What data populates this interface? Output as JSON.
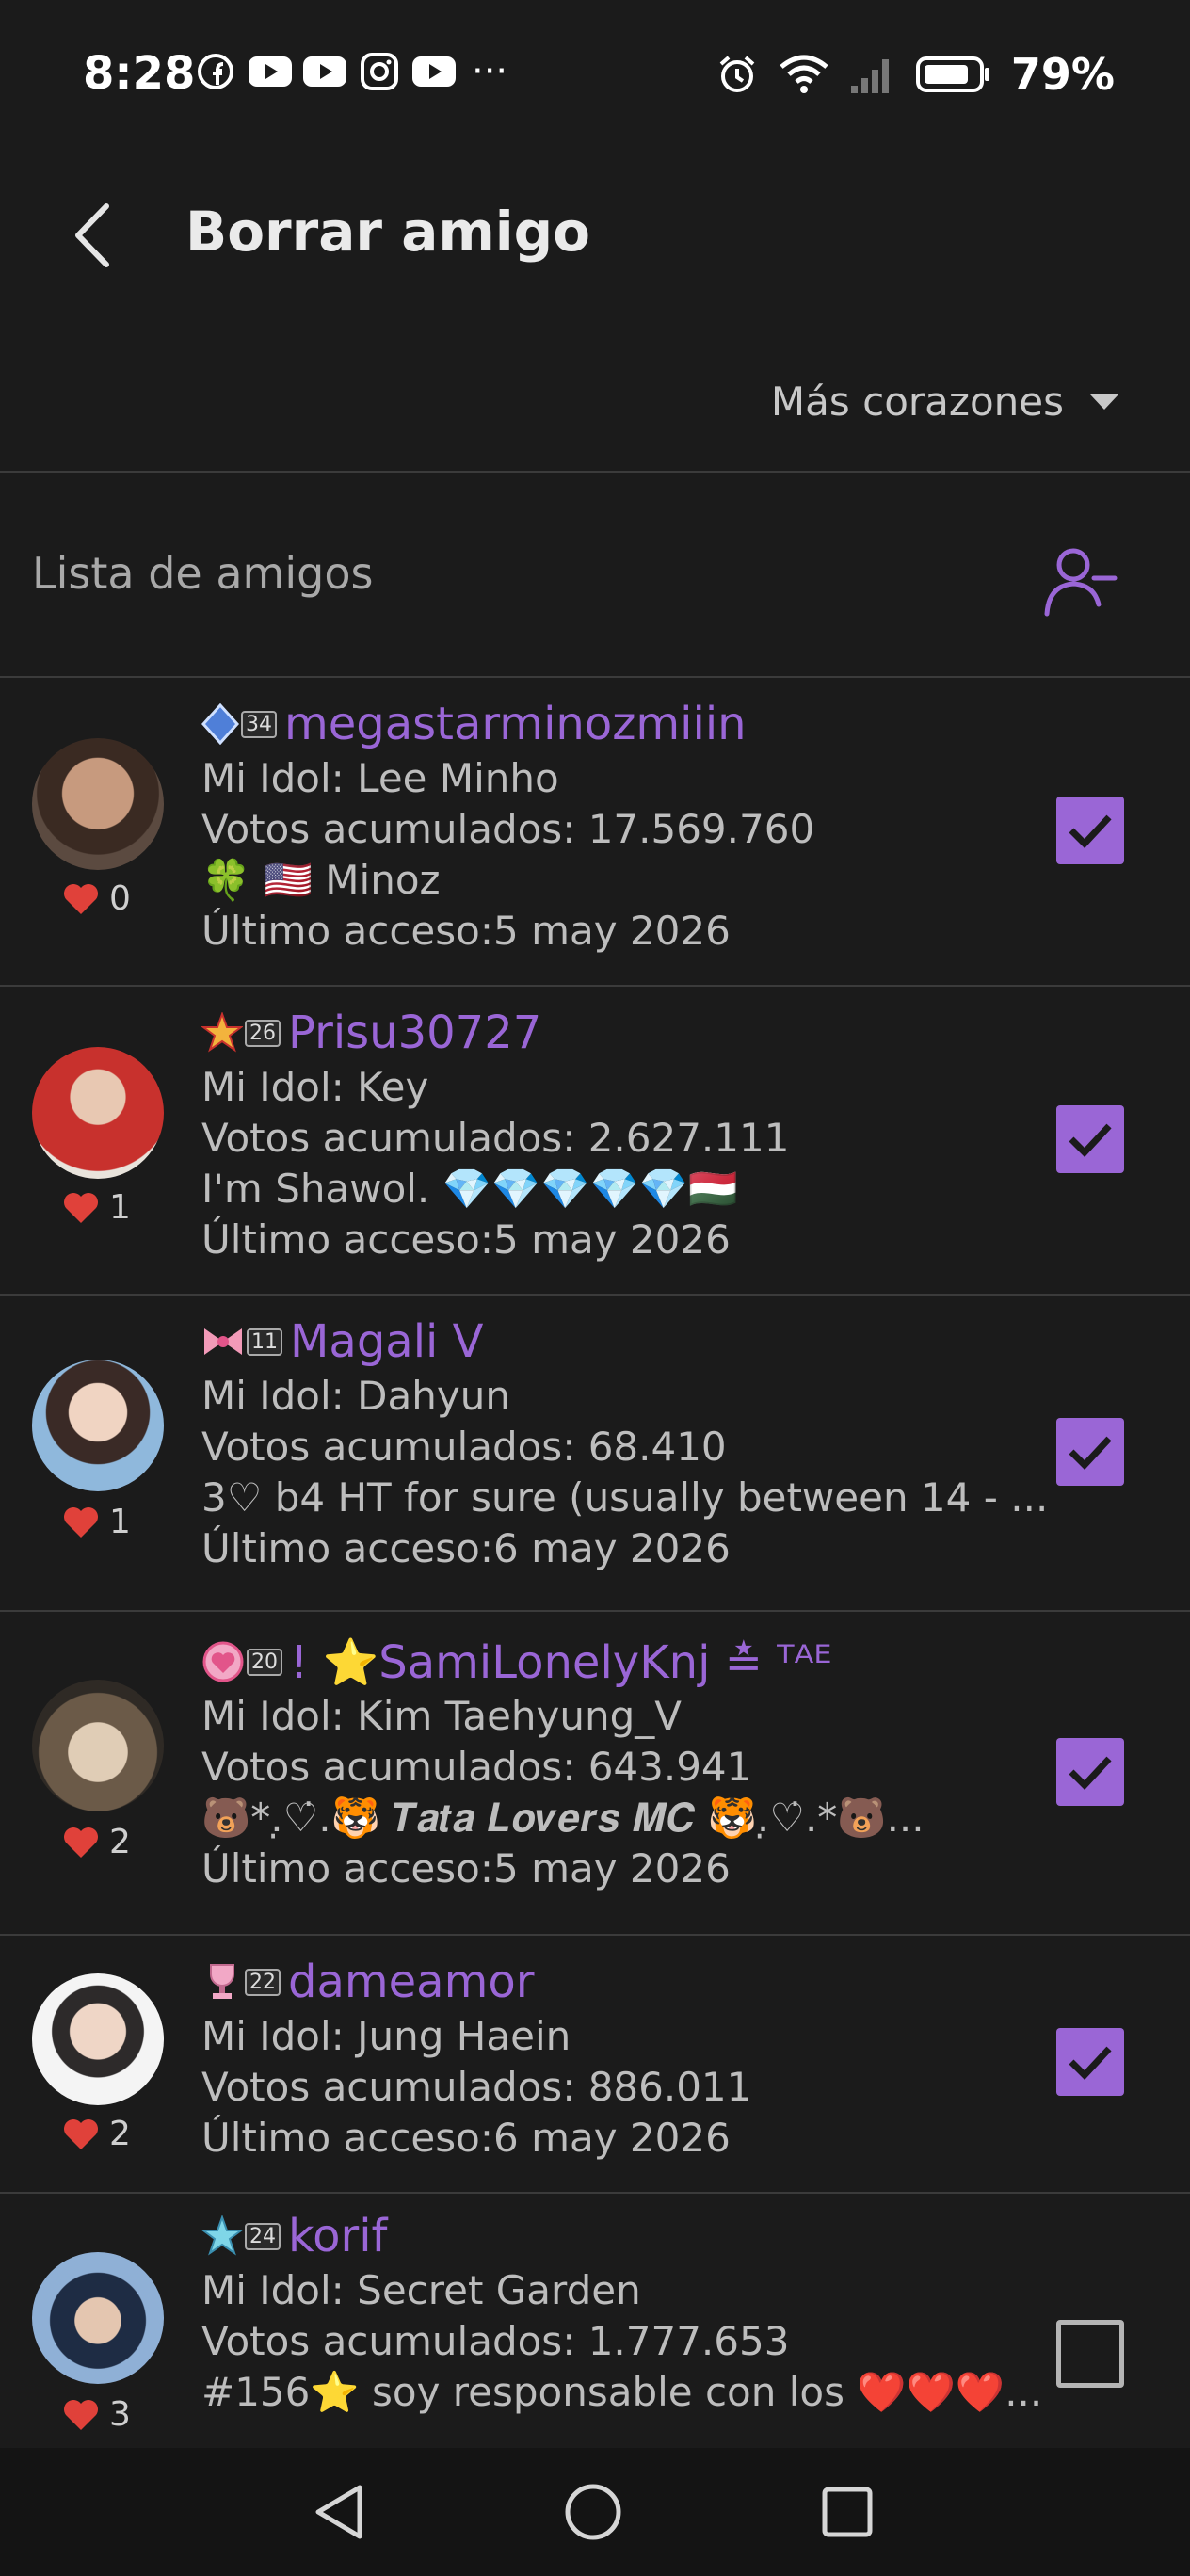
{
  "status_bar": {
    "time": "8:28",
    "battery": "79%"
  },
  "header": {
    "title": "Borrar amigo"
  },
  "sort": {
    "label": "Más corazones"
  },
  "list": {
    "title": "Lista de amigos"
  },
  "friends": [
    {
      "level": "34",
      "name": "megastarminozmiiin",
      "hearts": "0",
      "idol": "Mi Idol: Lee Minho",
      "votes": "Votos acumulados: 17.569.760",
      "status": "🍀 🇺🇸 Minoz",
      "last": "Último acceso:5 may 2026",
      "checked": true
    },
    {
      "level": "26",
      "name": "Prisu30727",
      "hearts": "1",
      "idol": "Mi Idol: Key",
      "votes": "Votos acumulados: 2.627.111",
      "status": "I'm Shawol. 💎💎💎💎💎🇭🇺",
      "last": "Último acceso:5 may 2026",
      "checked": true
    },
    {
      "level": "11",
      "name": "Magali V",
      "hearts": "1",
      "idol": "Mi Idol: Dahyun",
      "votes": "Votos acumulados: 68.410",
      "status": " 3♡ b4 HT for sure (usually between 14 - ...",
      "last": "Último acceso:6 may 2026",
      "checked": true
    },
    {
      "level": "20",
      "name": "! ⭐SamiLonelyKnj ≛ ᵀᴬᴱ",
      "hearts": "2",
      "idol": "Mi Idol: Kim Taehyung_V",
      "votes": "Votos acumulados: 643.941",
      "status": "🐻*.̣♡̇.🐯 𝑻𝒂𝒕𝒂 𝑳𝒐𝒗𝒆𝒓𝒔 𝑴𝑪 🐯.̣♡̇.*🐻...",
      "last": "Último acceso:5 may 2026",
      "checked": true
    },
    {
      "level": "22",
      "name": "dameamor",
      "hearts": "2",
      "idol": "Mi Idol: Jung Haein",
      "votes": "Votos acumulados: 886.011",
      "status": "",
      "last": "Último acceso:6 may 2026",
      "checked": true
    },
    {
      "level": "24",
      "name": "korif",
      "hearts": "3",
      "idol": "Mi Idol: Secret Garden",
      "votes": "Votos acumulados: 1.777.653",
      "status": "#156⭐ soy responsable con los ❤️❤️❤️...",
      "last": "",
      "checked": false
    }
  ],
  "colors": {
    "accent": "#9a66d6",
    "background": "#1b1b1b",
    "heart": "#e0413a"
  }
}
